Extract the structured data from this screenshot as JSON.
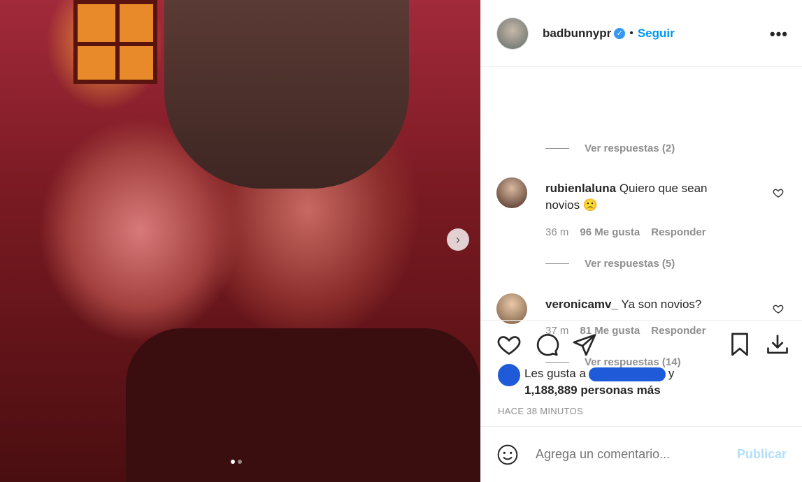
{
  "header": {
    "username": "badbunnypr",
    "bullet": "•",
    "follow_label": "Seguir",
    "more_label": "•••"
  },
  "comments": {
    "replies_1": "Ver respuestas (2)",
    "items": [
      {
        "username": "rubienlaluna",
        "text": "Quiero que sean novios 🙁",
        "time": "36 m",
        "likes": "96 Me gusta",
        "reply_label": "Responder",
        "replies": "Ver respuestas (5)"
      },
      {
        "username": "veronicamv_",
        "text": "Ya son novios?",
        "time": "37 m",
        "likes": "81 Me gusta",
        "reply_label": "Responder",
        "replies": "Ver respuestas (14)"
      }
    ]
  },
  "likes": {
    "prefix": "Les gusta a",
    "suffix": "y",
    "count_line": "1,188,889 personas más"
  },
  "timestamp": "HACE 38 MINUTOS",
  "comment_input": {
    "placeholder": "Agrega un comentario...",
    "publish_label": "Publicar"
  },
  "carousel": {
    "next_glyph": "›",
    "slide": 1,
    "slides": 2
  },
  "colors": {
    "accent": "#0095f6",
    "publish_disabled": "#b2dffc",
    "verified": "#3897f0"
  }
}
